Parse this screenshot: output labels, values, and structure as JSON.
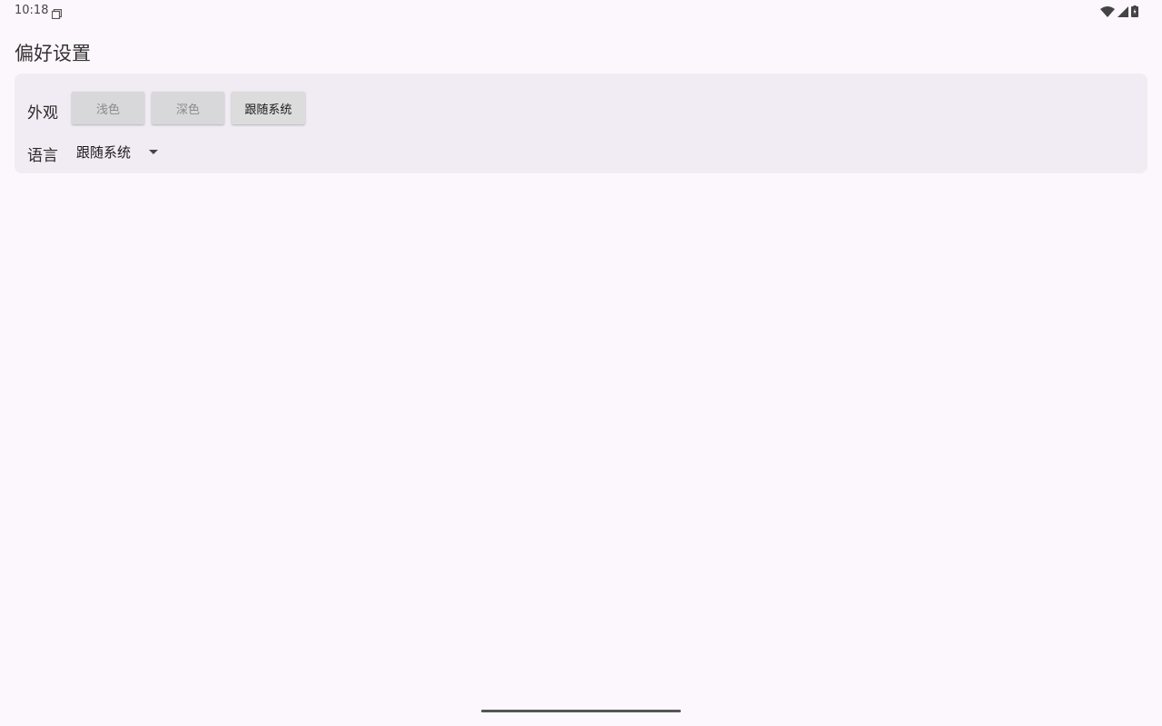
{
  "statusbar": {
    "time": "10:18",
    "icons": [
      "notification-icon",
      "wifi-icon",
      "cellular-signal-icon",
      "battery-icon"
    ]
  },
  "page": {
    "title": "偏好设置"
  },
  "appearance": {
    "label": "外观",
    "options": [
      {
        "label": "浅色",
        "selected": false
      },
      {
        "label": "深色",
        "selected": false
      },
      {
        "label": "跟随系统",
        "selected": true
      }
    ]
  },
  "language": {
    "label": "语言",
    "selected_value": "跟随系统"
  },
  "colors": {
    "background": "#fcf7fc",
    "card": "#f1ecf4",
    "button": "#d8d8da"
  }
}
